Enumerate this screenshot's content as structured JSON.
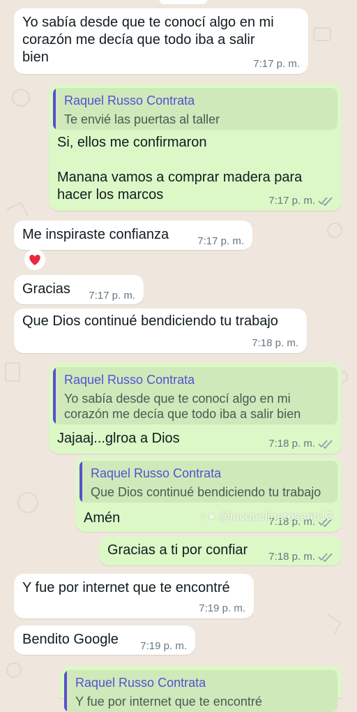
{
  "chat": {
    "messages": [
      {
        "id": "m1",
        "direction": "incoming",
        "text": "Yo sabía desde que te conocí algo en mi\ncorazón me decía que todo iba a salir\nbien",
        "time": "7:17 p. m."
      },
      {
        "id": "m2",
        "direction": "outgoing",
        "reply_to": {
          "author": "Raquel Russo Contrata",
          "text": "Te envié las puertas al taller"
        },
        "text": "Si, ellos me confirmaron\n\nManana vamos a comprar madera para\nhacer los marcos",
        "time": "7:17 p. m.",
        "status": "read"
      },
      {
        "id": "m3",
        "direction": "incoming",
        "text": "Me inspiraste confianza",
        "time": "7:17 p. m.",
        "reaction": "heart"
      },
      {
        "id": "m4",
        "direction": "incoming",
        "text": "Gracias",
        "time": "7:17 p. m."
      },
      {
        "id": "m5",
        "direction": "incoming",
        "text": "Que Dios continué bendiciendo tu trabajo",
        "time": "7:18 p. m."
      },
      {
        "id": "m6",
        "direction": "outgoing",
        "reply_to": {
          "author": "Raquel Russo Contrata",
          "text": "Yo sabía desde que te conocí algo en mi\ncorazón me decía que todo iba a salir bien"
        },
        "text": "Jajaaj...glroa a Dios",
        "time": "7:18 p. m.",
        "status": "read"
      },
      {
        "id": "m7",
        "direction": "outgoing",
        "reply_to": {
          "author": "Raquel Russo Contrata",
          "text": "Que Dios continué bendiciendo tu trabajo"
        },
        "text": "Amén",
        "time": "7:18 p. m.",
        "status": "read"
      },
      {
        "id": "m8",
        "direction": "outgoing",
        "text": "Gracias a ti por confiar",
        "time": "7:18 p. m.",
        "status": "read"
      },
      {
        "id": "m9",
        "direction": "incoming",
        "text": "Y fue por internet que te encontré",
        "time": "7:19 p. m."
      },
      {
        "id": "m10",
        "direction": "incoming",
        "text": "Bendito Google",
        "time": "7:19 p. m."
      },
      {
        "id": "m11",
        "direction": "outgoing",
        "reply_to": {
          "author": "Raquel Russo Contrata",
          "text": "Y fue por internet que te encontré"
        }
      }
    ]
  },
  "watermark": {
    "handle": "@jacquelinerosario13"
  },
  "colors": {
    "incoming_bubble": "#ffffff",
    "outgoing_bubble": "#dcf8c6",
    "quote_bar": "#5a4fcf",
    "read_ticks": "#53bdeb"
  }
}
